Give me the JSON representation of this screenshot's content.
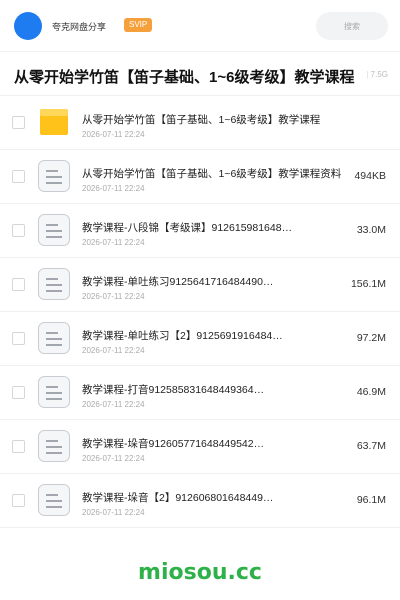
{
  "header": {
    "brand": "夸克网盘分享",
    "badge": "SVIP",
    "search_placeholder": "搜索"
  },
  "title": {
    "text": "从零开始学竹笛【笛子基础、1~6级考级】教学课程",
    "meta_prefix": "|",
    "meta_size": "7.5G"
  },
  "files": [
    {
      "name": "从零开始学竹笛【笛子基础、1~6级考级】教学课程",
      "date": "2026-07-11 22:24",
      "size": "",
      "icon": "folder-icon"
    },
    {
      "name": "从零开始学竹笛【笛子基础、1~6级考级】教学课程资料",
      "date": "2026-07-11 22:24",
      "size": "494KB",
      "icon": "document-icon"
    },
    {
      "name": "教学课程-八段锦【考级课】912615981648…",
      "date": "2026-07-11 22:24",
      "size": "33.0M",
      "icon": "document-icon"
    },
    {
      "name": "教学课程-单吐练习9125641716484490…",
      "date": "2026-07-11 22:24",
      "size": "156.1M",
      "icon": "document-icon"
    },
    {
      "name": "教学课程-单吐练习【2】9125691916484…",
      "date": "2026-07-11 22:24",
      "size": "97.2M",
      "icon": "document-icon"
    },
    {
      "name": "教学课程-打音912585831648449364…",
      "date": "2026-07-11 22:24",
      "size": "46.9M",
      "icon": "document-icon"
    },
    {
      "name": "教学课程-垛音9126057716484495​42…",
      "date": "2026-07-11 22:24",
      "size": "63.7M",
      "icon": "document-icon"
    },
    {
      "name": "教学课程-垛音【2】912606801648449…",
      "date": "2026-07-11 22:24",
      "size": "96.1M",
      "icon": "document-icon"
    }
  ],
  "watermark": "miosou.cc",
  "colors": {
    "accent": "#1f7cf0",
    "svip": "#f6a03c",
    "folder": "#ffc21a",
    "watermark": "#2fb14a"
  }
}
